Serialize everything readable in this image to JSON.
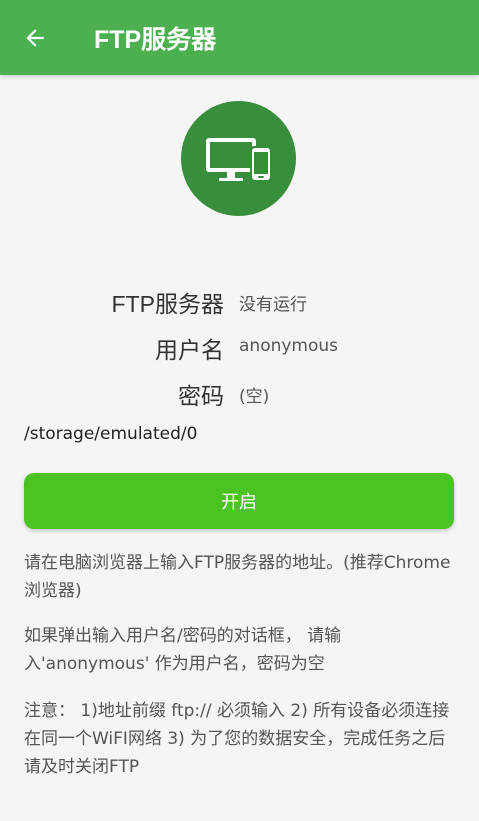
{
  "appbar": {
    "back_icon": "arrow-left-icon",
    "title": "FTP服务器"
  },
  "hero": {
    "icon": "desktop-and-phone-icon",
    "bg_color": "#388e3c"
  },
  "info": {
    "server_label": "FTP服务器",
    "server_value": "没有运行",
    "user_label": "用户名",
    "user_value": "anonymous",
    "password_label": "密码",
    "password_value": "(空)"
  },
  "path": "/storage/emulated/0",
  "start_button": {
    "label": "开启",
    "color": "#4bc323"
  },
  "notes": {
    "note1": "请在电脑浏览器上输入FTP服务器的地址。(推荐Chrome浏览器)",
    "note2": "如果弹出输入用户名/密码的对话框， 请输入'anonymous' 作为用户名，密码为空",
    "note3": "注意： 1)地址前缀 ftp:// 必须输入 2) 所有设备必须连接在同一个WiFI网络 3) 为了您的数据安全，完成任务之后请及时关闭FTP"
  },
  "colors": {
    "appbar": "#4caf50",
    "background": "#f5f5f5"
  }
}
